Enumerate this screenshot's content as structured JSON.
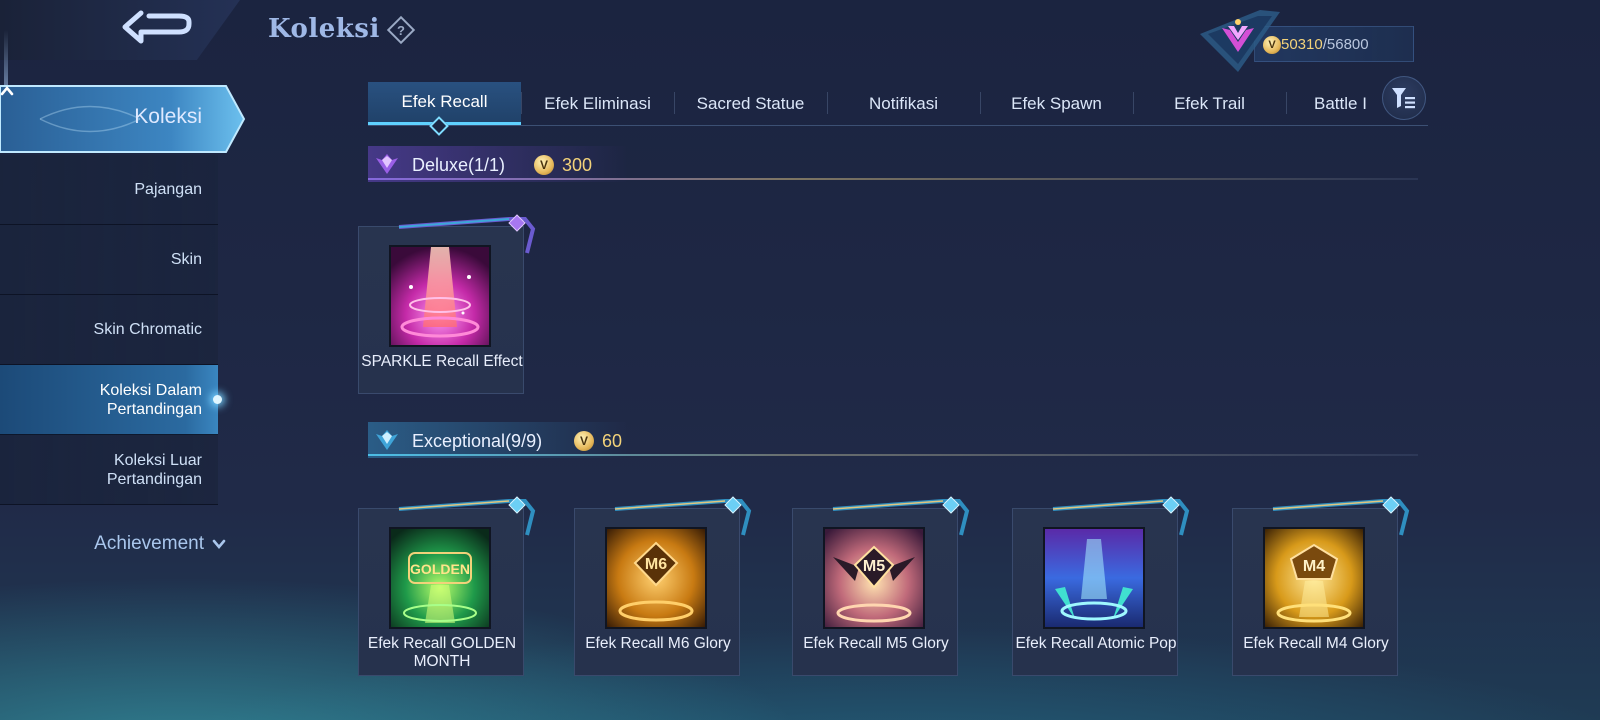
{
  "header": {
    "title": "Koleksi",
    "help_icon": "question-diamond-icon",
    "back_icon": "back-arrow-icon"
  },
  "points": {
    "current": "50310",
    "separator": "/",
    "max": "56800",
    "coin_glyph": "V",
    "rank_icon": "rank-badge-icon"
  },
  "sidebar": {
    "main_label": "Koleksi",
    "items": [
      {
        "label": "Pajangan"
      },
      {
        "label": "Skin"
      },
      {
        "label": "Skin Chromatic"
      },
      {
        "label": "Koleksi Dalam Pertandingan",
        "active": true
      },
      {
        "label": "Koleksi Luar Pertandingan"
      }
    ],
    "achievement_label": "Achievement"
  },
  "tabs": [
    {
      "label": "Efek Recall",
      "active": true
    },
    {
      "label": "Efek Eliminasi"
    },
    {
      "label": "Sacred Statue"
    },
    {
      "label": "Notifikasi"
    },
    {
      "label": "Efek Spawn"
    },
    {
      "label": "Efek Trail"
    },
    {
      "label": "Battle I"
    }
  ],
  "sections": {
    "deluxe": {
      "name": "Deluxe",
      "count": "(1/1)",
      "points": "300",
      "coin_glyph": "V"
    },
    "exceptional": {
      "name": "Exceptional",
      "count": "(9/9)",
      "points": "60",
      "coin_glyph": "V"
    }
  },
  "items": {
    "deluxe": [
      {
        "name": "SPARKLE Recall Effect"
      }
    ],
    "exceptional": [
      {
        "name": "Efek Recall GOLDEN MONTH",
        "thumb_text": "GOLDEN"
      },
      {
        "name": "Efek Recall M6 Glory",
        "thumb_text": "M6"
      },
      {
        "name": "Efek Recall M5 Glory",
        "thumb_text": "M5"
      },
      {
        "name": "Efek Recall Atomic Pop",
        "thumb_text": ""
      },
      {
        "name": "Efek Recall M4 Glory",
        "thumb_text": "M4"
      }
    ]
  },
  "colors": {
    "accent_cyan": "#5fd1ff",
    "gold": "#f2d27a",
    "deluxe_purple": "#8c6ee6",
    "exceptional_blue": "#50c8f0"
  }
}
